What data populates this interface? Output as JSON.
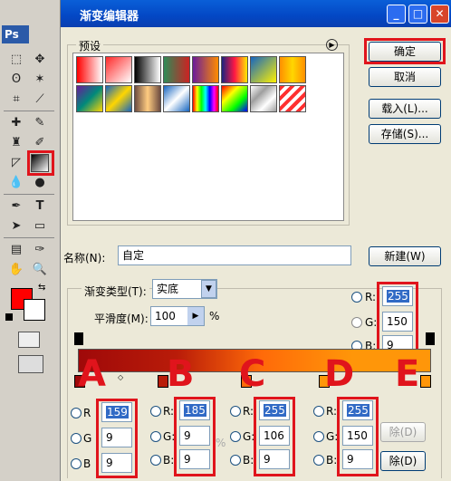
{
  "app": {
    "logo": "Ps"
  },
  "window": {
    "title": "渐变编辑器",
    "min_label": "_",
    "max_label": "□",
    "close_label": "✕"
  },
  "presets": {
    "label": "预设",
    "menu_icon": "play-circle-icon",
    "swatches": [
      "linear-gradient(90deg,#ff0000,#ffffff)",
      "linear-gradient(135deg,#ff2a2a,#ffffff)",
      "linear-gradient(90deg,#000000,#ffffff)",
      "linear-gradient(90deg,#2e8b57,#cc2222)",
      "linear-gradient(90deg,#6a1b9a,#ff8c00)",
      "linear-gradient(90deg,#1a237e,#ff1744,#ffea00)",
      "linear-gradient(135deg,#1565c0,#fff200)",
      "linear-gradient(90deg,#ff8f00,#ffd600,#ff8f00)",
      "linear-gradient(135deg,#6a1b9a,#00897b,#ffd600)",
      "linear-gradient(135deg,#1565c0,#ffd600,#1565c0)",
      "linear-gradient(90deg,#6d4c41,#ffcc80,#6d4c41)",
      "linear-gradient(135deg,#1565c0,#ffffff,#1565c0)",
      "linear-gradient(90deg,#ff0000,#ffff00,#00ff00,#00ffff,#0000ff,#ff00ff,#ff0000)",
      "linear-gradient(135deg,#ff0000,#ffff00,#00ff00,#0000ff)",
      "linear-gradient(135deg,#ffffff,#9e9e9e,#ffffff,#9e9e9e)",
      "repeating-linear-gradient(135deg,#ff3030 0 4px,#ffffff 4px 8px)"
    ]
  },
  "buttons": {
    "ok": "确定",
    "cancel": "取消",
    "load": "载入(L)...",
    "save": "存储(S)...",
    "new": "新建(W)",
    "delete_a": "除(D)",
    "delete_b": "除(D)"
  },
  "name_row": {
    "label": "名称(N):",
    "value": "自定"
  },
  "gradient_type": {
    "label": "渐变类型(T):",
    "value": "实底"
  },
  "smoothness": {
    "label": "平滑度(M):",
    "value": "100",
    "unit": "%"
  },
  "gradient_bar": "linear-gradient(90deg,#9f0909 0%,#b91c09 28%,#ff6a09 52%,#ff9609 78%,#ff9609 100%)",
  "rgb_top": {
    "r_label": "R:",
    "g_label": "G:",
    "b_label": "B:",
    "r": "255",
    "g": "150",
    "b": "9"
  },
  "panels": [
    {
      "letter": "A",
      "r_label": "R",
      "g_label": "G",
      "b_label": "B",
      "r": "159",
      "g": "9",
      "b": "9"
    },
    {
      "letter": "B",
      "r_label": "R:",
      "g_label": "G:",
      "b_label": "B:",
      "r": "185",
      "g": "9",
      "b": "9"
    },
    {
      "letter": "C",
      "r_label": "R:",
      "g_label": "G:",
      "b_label": "B:",
      "r": "255",
      "g": "106",
      "b": "9"
    },
    {
      "letter": "D",
      "r_label": "R:",
      "g_label": "G:",
      "b_label": "B:",
      "r": "255",
      "g": "150",
      "b": "9"
    }
  ],
  "letter_e": "E",
  "percent_faint": "%",
  "colors": {
    "fg": "#ff0000",
    "bg": "#ffffff",
    "accent": "#e0141c"
  }
}
